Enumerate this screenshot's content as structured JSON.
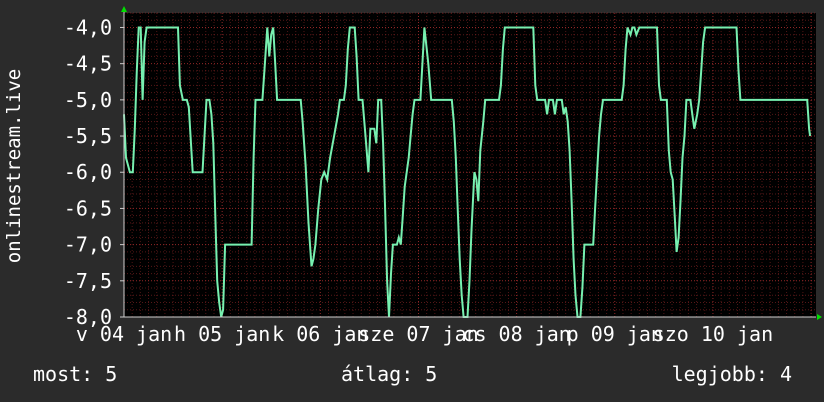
{
  "chart_data": {
    "type": "line",
    "ylabel": "onlinestream.live",
    "ylim": [
      -8,
      -3.8
    ],
    "yticks": [
      -4.0,
      -4.5,
      -5.0,
      -5.5,
      -6.0,
      -6.5,
      -7.0,
      -7.5,
      -8.0
    ],
    "ytick_labels": [
      "-4,0",
      "-4,5",
      "-5,0",
      "-5,5",
      "-6,0",
      "-6,5",
      "-7,0",
      "-7,5",
      "-8,0"
    ],
    "xlim": [
      0,
      7.05
    ],
    "xticks": [
      0,
      1,
      2,
      3,
      4,
      5,
      6
    ],
    "xtick_labels": [
      "v 04 jan",
      "h 05 jan",
      "k 06 jan",
      "sze 07 jan",
      "cs 08 jan",
      "p 09 jan",
      "szo 10 jan"
    ],
    "grid": true,
    "colors": {
      "line": "#77f0b0",
      "grid": "#9b2a2a",
      "axis": "#ffffff",
      "arrow": "#00e000",
      "background": "#2b2b2b"
    },
    "series": [
      {
        "values": [
          [
            0.0,
            -5.2
          ],
          [
            0.02,
            -5.8
          ],
          [
            0.06,
            -6.0
          ],
          [
            0.09,
            -6.0
          ],
          [
            0.11,
            -5.4
          ],
          [
            0.13,
            -4.6
          ],
          [
            0.15,
            -4.0
          ],
          [
            0.17,
            -4.0
          ],
          [
            0.19,
            -5.0
          ],
          [
            0.21,
            -4.2
          ],
          [
            0.23,
            -4.0
          ],
          [
            0.55,
            -4.0
          ],
          [
            0.57,
            -4.8
          ],
          [
            0.6,
            -5.0
          ],
          [
            0.64,
            -5.0
          ],
          [
            0.66,
            -5.1
          ],
          [
            0.7,
            -6.0
          ],
          [
            0.8,
            -6.0
          ],
          [
            0.82,
            -5.5
          ],
          [
            0.84,
            -5.0
          ],
          [
            0.87,
            -5.0
          ],
          [
            0.89,
            -5.2
          ],
          [
            0.91,
            -5.6
          ],
          [
            0.93,
            -6.6
          ],
          [
            0.95,
            -7.5
          ],
          [
            0.97,
            -7.8
          ],
          [
            0.99,
            -8.0
          ],
          [
            1.01,
            -7.9
          ],
          [
            1.03,
            -7.0
          ],
          [
            1.3,
            -7.0
          ],
          [
            1.32,
            -5.8
          ],
          [
            1.34,
            -5.0
          ],
          [
            1.41,
            -5.0
          ],
          [
            1.43,
            -4.6
          ],
          [
            1.46,
            -4.0
          ],
          [
            1.48,
            -4.4
          ],
          [
            1.5,
            -4.1
          ],
          [
            1.52,
            -4.0
          ],
          [
            1.54,
            -4.5
          ],
          [
            1.56,
            -5.0
          ],
          [
            1.8,
            -5.0
          ],
          [
            1.82,
            -5.3
          ],
          [
            1.85,
            -5.9
          ],
          [
            1.88,
            -6.7
          ],
          [
            1.91,
            -7.3
          ],
          [
            1.93,
            -7.2
          ],
          [
            1.95,
            -7.0
          ],
          [
            1.98,
            -6.5
          ],
          [
            2.01,
            -6.1
          ],
          [
            2.04,
            -6.0
          ],
          [
            2.07,
            -6.1
          ],
          [
            2.1,
            -5.8
          ],
          [
            2.14,
            -5.5
          ],
          [
            2.18,
            -5.2
          ],
          [
            2.2,
            -5.0
          ],
          [
            2.24,
            -5.0
          ],
          [
            2.26,
            -4.8
          ],
          [
            2.28,
            -4.3
          ],
          [
            2.3,
            -4.0
          ],
          [
            2.35,
            -4.0
          ],
          [
            2.37,
            -4.4
          ],
          [
            2.39,
            -5.0
          ],
          [
            2.43,
            -5.0
          ],
          [
            2.46,
            -5.5
          ],
          [
            2.49,
            -6.0
          ],
          [
            2.51,
            -5.4
          ],
          [
            2.55,
            -5.4
          ],
          [
            2.57,
            -5.6
          ],
          [
            2.59,
            -5.0
          ],
          [
            2.62,
            -5.0
          ],
          [
            2.64,
            -5.6
          ],
          [
            2.66,
            -6.5
          ],
          [
            2.68,
            -7.5
          ],
          [
            2.7,
            -8.0
          ],
          [
            2.72,
            -7.4
          ],
          [
            2.74,
            -7.0
          ],
          [
            2.78,
            -7.0
          ],
          [
            2.8,
            -6.9
          ],
          [
            2.82,
            -7.0
          ],
          [
            2.84,
            -6.6
          ],
          [
            2.86,
            -6.2
          ],
          [
            2.88,
            -6.0
          ],
          [
            2.9,
            -5.8
          ],
          [
            2.92,
            -5.5
          ],
          [
            2.94,
            -5.2
          ],
          [
            2.96,
            -5.0
          ],
          [
            3.02,
            -5.0
          ],
          [
            3.04,
            -4.5
          ],
          [
            3.06,
            -4.0
          ],
          [
            3.1,
            -4.5
          ],
          [
            3.13,
            -5.0
          ],
          [
            3.34,
            -5.0
          ],
          [
            3.36,
            -5.3
          ],
          [
            3.38,
            -5.8
          ],
          [
            3.4,
            -6.5
          ],
          [
            3.42,
            -7.2
          ],
          [
            3.44,
            -7.7
          ],
          [
            3.46,
            -8.0
          ],
          [
            3.5,
            -8.0
          ],
          [
            3.52,
            -7.5
          ],
          [
            3.54,
            -6.8
          ],
          [
            3.57,
            -6.0
          ],
          [
            3.59,
            -6.1
          ],
          [
            3.61,
            -6.4
          ],
          [
            3.63,
            -5.7
          ],
          [
            3.66,
            -5.3
          ],
          [
            3.68,
            -5.0
          ],
          [
            3.82,
            -5.0
          ],
          [
            3.84,
            -4.8
          ],
          [
            3.86,
            -4.3
          ],
          [
            3.88,
            -4.0
          ],
          [
            4.17,
            -4.0
          ],
          [
            4.19,
            -4.8
          ],
          [
            4.21,
            -5.0
          ],
          [
            4.29,
            -5.0
          ],
          [
            4.31,
            -5.2
          ],
          [
            4.33,
            -5.0
          ],
          [
            4.37,
            -5.0
          ],
          [
            4.39,
            -5.2
          ],
          [
            4.41,
            -5.0
          ],
          [
            4.46,
            -5.0
          ],
          [
            4.48,
            -5.2
          ],
          [
            4.5,
            -5.1
          ],
          [
            4.52,
            -5.3
          ],
          [
            4.54,
            -5.7
          ],
          [
            4.56,
            -6.4
          ],
          [
            4.58,
            -7.2
          ],
          [
            4.6,
            -7.7
          ],
          [
            4.62,
            -8.0
          ],
          [
            4.65,
            -8.0
          ],
          [
            4.67,
            -7.6
          ],
          [
            4.69,
            -7.0
          ],
          [
            4.71,
            -7.0
          ],
          [
            4.78,
            -7.0
          ],
          [
            4.8,
            -6.5
          ],
          [
            4.82,
            -6.0
          ],
          [
            4.84,
            -5.5
          ],
          [
            4.86,
            -5.2
          ],
          [
            4.88,
            -5.0
          ],
          [
            5.07,
            -5.0
          ],
          [
            5.09,
            -4.8
          ],
          [
            5.11,
            -4.3
          ],
          [
            5.13,
            -4.0
          ],
          [
            5.16,
            -4.1
          ],
          [
            5.18,
            -4.0
          ],
          [
            5.2,
            -4.0
          ],
          [
            5.22,
            -4.1
          ],
          [
            5.25,
            -4.0
          ],
          [
            5.43,
            -4.0
          ],
          [
            5.45,
            -4.8
          ],
          [
            5.47,
            -5.0
          ],
          [
            5.53,
            -5.0
          ],
          [
            5.55,
            -5.7
          ],
          [
            5.57,
            -6.0
          ],
          [
            5.59,
            -6.1
          ],
          [
            5.61,
            -6.6
          ],
          [
            5.63,
            -7.1
          ],
          [
            5.65,
            -6.9
          ],
          [
            5.67,
            -6.4
          ],
          [
            5.69,
            -5.8
          ],
          [
            5.71,
            -5.5
          ],
          [
            5.73,
            -5.0
          ],
          [
            5.77,
            -5.0
          ],
          [
            5.79,
            -5.2
          ],
          [
            5.81,
            -5.4
          ],
          [
            5.84,
            -5.2
          ],
          [
            5.86,
            -5.0
          ],
          [
            5.88,
            -4.6
          ],
          [
            5.9,
            -4.2
          ],
          [
            5.92,
            -4.0
          ],
          [
            6.24,
            -4.0
          ],
          [
            6.26,
            -4.6
          ],
          [
            6.28,
            -5.0
          ],
          [
            6.96,
            -5.0
          ],
          [
            6.98,
            -5.4
          ],
          [
            6.99,
            -5.5
          ]
        ]
      }
    ]
  },
  "stats": {
    "now_label": "most:",
    "now_value": "5",
    "avg_label": "átlag:",
    "avg_value": "5",
    "best_label": "legjobb:",
    "best_value": "4"
  }
}
